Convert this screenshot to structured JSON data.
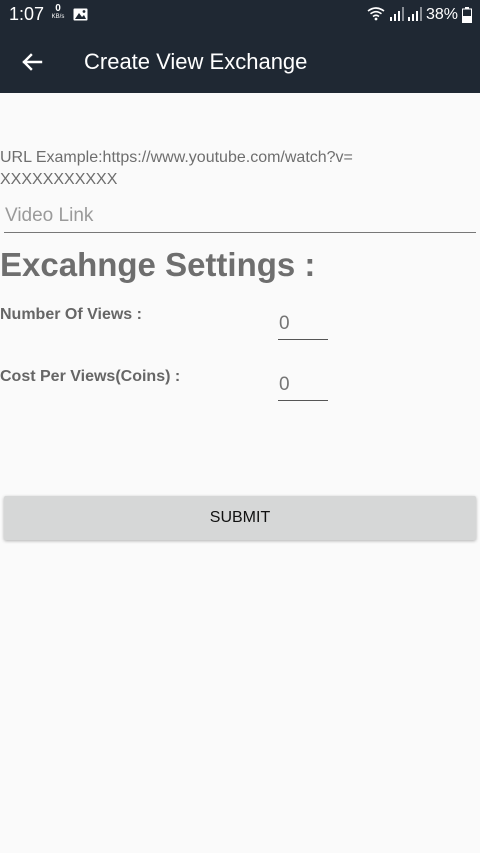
{
  "status_bar": {
    "time": "1:07",
    "net_speed_value": "0",
    "net_speed_unit": "KB/s",
    "battery": "38%",
    "icons": [
      "gallery-icon",
      "wifi-icon",
      "signal-icon",
      "signal-icon",
      "battery-icon"
    ]
  },
  "app_bar": {
    "back_icon": "arrow-left-icon",
    "title": "Create View Exchange",
    "background_color": "#1f2833"
  },
  "form": {
    "url_hint": "URL Example:https://www.youtube.com/watch?v=\nXXXXXXXXXXX",
    "video_link": {
      "value": "",
      "placeholder": "Video Link"
    },
    "settings_heading": "Excahnge Settings :",
    "number_of_views": {
      "label": "Number Of Views :",
      "value": "",
      "placeholder": "0"
    },
    "cost_per_views": {
      "label": "Cost Per Views(Coins) :",
      "value": "",
      "placeholder": "0"
    },
    "submit_label": "SUBMIT"
  }
}
